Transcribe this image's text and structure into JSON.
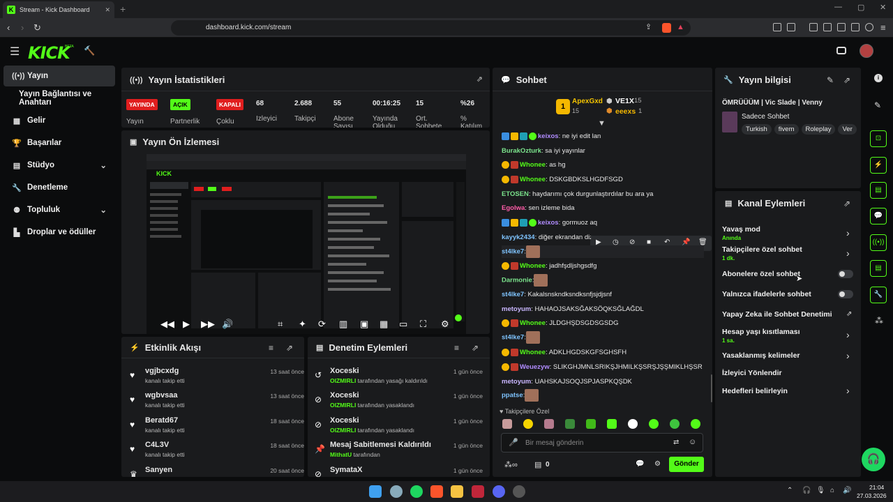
{
  "browser": {
    "tab_title": "Stream - Kick Dashboard",
    "url": "dashboard.kick.com/stream"
  },
  "brand": {
    "logo": "KICK",
    "beta": "BETA",
    "accent": "#53fc18"
  },
  "sidebar": {
    "items": [
      {
        "label": "Yayın",
        "icon": "broadcast-icon"
      },
      {
        "label": "Yayın Bağlantısı ve Anahtarı",
        "icon": ""
      },
      {
        "label": "Gelir",
        "icon": "revenue-icon"
      },
      {
        "label": "Başarılar",
        "icon": "trophy-icon"
      },
      {
        "label": "Stüdyo",
        "icon": "studio-icon"
      },
      {
        "label": "Denetleme",
        "icon": "wrench-icon"
      },
      {
        "label": "Topluluk",
        "icon": "community-icon"
      },
      {
        "label": "Droplar ve ödüller",
        "icon": "drops-icon"
      }
    ]
  },
  "stats": {
    "title": "Yayın İstatistikleri",
    "badges": [
      {
        "badge": "YAYINDA",
        "label": "Yayın"
      },
      {
        "badge": "AÇIK",
        "label": "Partnerlik"
      },
      {
        "badge": "KAPALI",
        "label": "Çoklu"
      }
    ],
    "values": [
      {
        "value": "68",
        "label": "İzleyici"
      },
      {
        "value": "2.688",
        "label": "Takipçi"
      },
      {
        "value": "55",
        "label": "Abone Sayısı"
      },
      {
        "value": "00:16:25",
        "label": "Yayında Olduğu"
      },
      {
        "value": "15",
        "label": "Ort. Sohbete"
      },
      {
        "value": "%26",
        "label": "% Katılım"
      }
    ]
  },
  "preview": {
    "title": "Yayın Ön İzlemesi"
  },
  "activity": {
    "title": "Etkinlik Akışı",
    "items": [
      {
        "name": "vgjbcxdg",
        "sub": "kanalı takip etti",
        "time": "13 saat önce"
      },
      {
        "name": "wgbvsaa",
        "sub": "kanalı takip etti",
        "time": "13 saat önce"
      },
      {
        "name": "Beratd67",
        "sub": "kanalı takip etti",
        "time": "18 saat önce"
      },
      {
        "name": "C4L3V",
        "sub": "kanalı takip etti",
        "time": "18 saat önce"
      },
      {
        "name": "Sanyen",
        "sub": "",
        "time": "20 saat önce"
      }
    ]
  },
  "moderation": {
    "title": "Denetim Eylemleri",
    "items": [
      {
        "name": "Xoceski",
        "actor": "OIZMIRLI",
        "sub": " tarafından yasağı kaldırıldı",
        "time": "1 gün önce"
      },
      {
        "name": "Xoceski",
        "actor": "OIZMIRLI",
        "sub": " tarafından yasaklandı",
        "time": "1 gün önce"
      },
      {
        "name": "Xoceski",
        "actor": "OIZMIRLI",
        "sub": " tarafından yasaklandı",
        "time": "1 gün önce"
      },
      {
        "name": "Mesaj Sabitlemesi Kaldırıldı",
        "actor": "MithatU",
        "sub": " tarafından",
        "time": "1 gün önce"
      },
      {
        "name": "SymataX",
        "actor": "",
        "sub": "",
        "time": "1 gün önce"
      }
    ]
  },
  "chat": {
    "title": "Sohbet",
    "top_gifters": [
      {
        "name": "ApexGxd",
        "count": "15"
      },
      {
        "name": "VE1X",
        "count": "15"
      },
      {
        "name": "eeexs",
        "count": "1"
      }
    ],
    "messages": [
      {
        "user": "keixos",
        "color": "#b18cff",
        "text": ": ne iyi edit lan"
      },
      {
        "user": "BurakOzturk",
        "color": "#7be38c",
        "text": ": sa iyi yayınlar"
      },
      {
        "user": "Whonee",
        "color": "#53fc18",
        "text": ": as hg"
      },
      {
        "user": "Whonee",
        "color": "#53fc18",
        "text": ": DSKGBDKSLHGDFSGD"
      },
      {
        "user": "ETOSEN",
        "color": "#7be38c",
        "text": ": haydarımı çok durgunlaştırdılar bu ara ya"
      },
      {
        "user": "Egolwa",
        "color": "#ff5ca8",
        "text": ": sen izleme bida"
      },
      {
        "user": "keixos",
        "color": "#b18cff",
        "text": ": gormuoz aq"
      },
      {
        "user": "kayyk2434",
        "color": "#7fc4ff",
        "text": ": diğer ekrandan diz"
      },
      {
        "user": "st4lke7",
        "color": "#7fc4ff",
        "text": ":"
      },
      {
        "user": "Whonee",
        "color": "#53fc18",
        "text": ": jadhfşdljshgsdfg"
      },
      {
        "user": "Darmonie",
        "color": "#7be38c",
        "text": ":"
      },
      {
        "user": "st4lke7",
        "color": "#7fc4ff",
        "text": ": Kakalsnskndksndksnfjsjdjsnf"
      },
      {
        "user": "metoyum",
        "color": "#c9b6ff",
        "text": ": HAHAOJSAKSĞAKSÖQKSĞLAĞDL"
      },
      {
        "user": "Whonee",
        "color": "#53fc18",
        "text": ": JLDGHŞDSGDSGSDG"
      },
      {
        "user": "st4lke7",
        "color": "#7fc4ff",
        "text": ":"
      },
      {
        "user": "Whonee",
        "color": "#53fc18",
        "text": ": ADKLHGDSKGFSGHSFH"
      },
      {
        "user": "Weuezyw",
        "color": "#b18cff",
        "text": ": SLIKGHJMNLSRIKŞJHMILKŞSRŞJŞŞMIKLHŞSR"
      },
      {
        "user": "metoyum",
        "color": "#c9b6ff",
        "text": ": UAHSKAJSOQJSPJASPKQŞDK"
      },
      {
        "user": "ppatse",
        "color": "#7fc4ff",
        "text": ":"
      }
    ],
    "followers_only": "Takipçilere Özel",
    "input_placeholder": "Bir mesaj gönderin",
    "points": "0",
    "send_label": "Gönder"
  },
  "stream_info": {
    "title": "Yayın bilgisi",
    "stream_title": "ÖMRÜÜÜM | Vic Slade | Venny",
    "category": "Sadece Sohbet",
    "tags": [
      "Turkish",
      "fivem",
      "Roleplay",
      "Ver"
    ]
  },
  "channel_actions": {
    "title": "Kanal Eylemleri",
    "items": [
      {
        "label": "Yavaş mod",
        "sub": "Anında",
        "control": "arrow"
      },
      {
        "label": "Takipçilere özel sohbet",
        "sub": "1 dk.",
        "control": "arrow"
      },
      {
        "label": "Abonelere özel sohbet",
        "sub": "",
        "control": "toggle"
      },
      {
        "label": "Yalnızca ifadelerle sohbet",
        "sub": "",
        "control": "toggle"
      },
      {
        "label": "Yapay Zeka ile Sohbet Denetimi",
        "sub": "",
        "control": "external"
      },
      {
        "label": "Hesap yaşı kısıtlaması",
        "sub": "1 sa.",
        "control": "arrow"
      },
      {
        "label": "Yasaklanmış kelimeler",
        "sub": "",
        "control": "arrow"
      },
      {
        "label": "İzleyici Yönlendir",
        "sub": "",
        "control": ""
      },
      {
        "label": "Hedefleri belirleyin",
        "sub": "",
        "control": "arrow"
      }
    ]
  },
  "taskbar": {
    "time": "21:04",
    "date": "27.03.2026"
  }
}
